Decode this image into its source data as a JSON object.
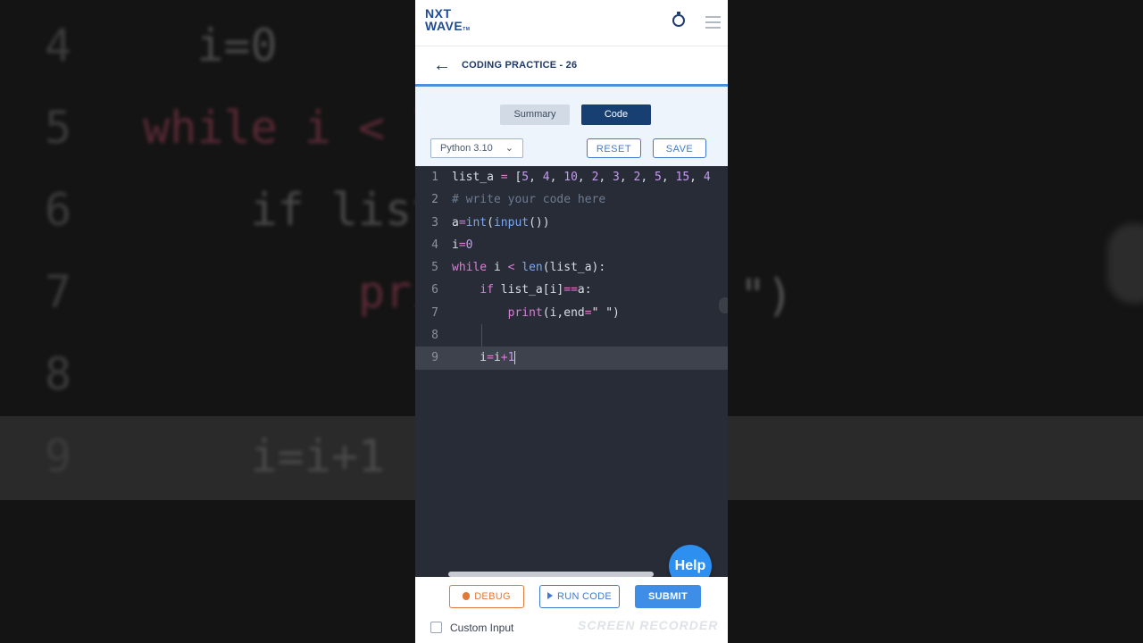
{
  "background": {
    "lines": [
      {
        "num": "4",
        "code": "i=0"
      },
      {
        "num": "5",
        "code": "while i < l"
      },
      {
        "num": "6",
        "code": "if list"
      },
      {
        "num": "7",
        "code": "pri"
      },
      {
        "num": "8",
        "code": ""
      },
      {
        "num": "9",
        "code": "i=i+1"
      }
    ],
    "right_fragment": "\")"
  },
  "header": {
    "logo_line1": "NXT",
    "logo_line2": "WAVE",
    "logo_tm": "TM",
    "timer_icon": "stopwatch-icon",
    "menu_icon": "hamburger-icon"
  },
  "page": {
    "back_icon": "←",
    "title": "CODING PRACTICE - 26"
  },
  "tabs": [
    {
      "label": "Summary",
      "active": false
    },
    {
      "label": "Code",
      "active": true
    }
  ],
  "toolbar": {
    "language": "Python 3.10",
    "reset_label": "RESET",
    "save_label": "SAVE"
  },
  "editor": {
    "line_numbers": [
      "1",
      "2",
      "3",
      "4",
      "5",
      "6",
      "7",
      "8",
      "9"
    ],
    "active_line": 9
  },
  "help_label": "Help",
  "footer": {
    "debug_label": "DEBUG",
    "run_label": "RUN CODE",
    "submit_label": "SUBMIT",
    "custom_input_label": "Custom Input",
    "watermark": "SCREEN RECORDER"
  },
  "colors": {
    "brand": "#1f4b8f",
    "accent": "#3e8ee8",
    "editor_bg": "#272c36",
    "debug": "#e07a3a"
  }
}
